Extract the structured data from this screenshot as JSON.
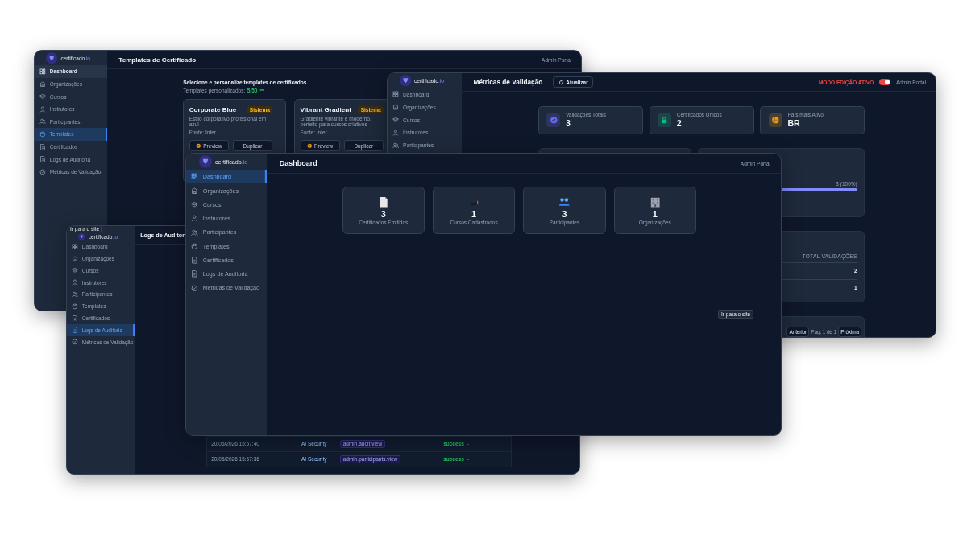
{
  "templates_window": {
    "sidebar": {
      "logo": "certificado",
      "logo_suffix": ".io",
      "items": [
        {
          "label": "Dashboard",
          "selected": false,
          "hovered": true
        },
        {
          "label": "Organizações",
          "selected": false,
          "hovered": false
        },
        {
          "label": "Cursos",
          "selected": false,
          "hovered": false
        },
        {
          "label": "Instrutores",
          "selected": false,
          "hovered": false
        },
        {
          "label": "Participantes",
          "selected": false,
          "hovered": false
        },
        {
          "label": "Templates",
          "selected": true,
          "hovered": false
        },
        {
          "label": "Certificados",
          "selected": false,
          "hovered": false
        },
        {
          "label": "Logs de Auditoria",
          "selected": false,
          "hovered": false
        },
        {
          "label": "Métricas de Validação",
          "selected": false,
          "hovered": false
        }
      ]
    },
    "header": {
      "title": "Templates de Certificado",
      "user": "Admin Portal"
    },
    "intro": "Selecione e personalize templates de certificados.",
    "counter_label": "Templates personalizados:",
    "counter_value": "5/50",
    "cards": [
      {
        "name": "Corporate Blue",
        "badge": "Sistema",
        "description": "Estilo corporativo profissional em azul",
        "font": "Fonte: Inter",
        "actions": [
          "Preview",
          "Duplicar"
        ]
      },
      {
        "name": "Vibrant Gradient",
        "badge": "Sistema",
        "description": "Gradiente vibrante e moderno, perfeito para cursos criativos",
        "font": "Fonte: Inter",
        "actions": [
          "Preview",
          "Duplicar"
        ]
      }
    ]
  },
  "metrics_window": {
    "sidebar": {
      "logo": "certificado",
      "logo_suffix": ".io",
      "items": [
        {
          "label": "Dashboard",
          "selected": false
        },
        {
          "label": "Organizações",
          "selected": false
        },
        {
          "label": "Cursos",
          "selected": false
        },
        {
          "label": "Instrutores",
          "selected": false
        },
        {
          "label": "Participantes",
          "selected": false
        }
      ]
    },
    "header": {
      "title": "Métricas de Validação",
      "refresh": "Atualizar",
      "mode_label": "MODO EDIÇÃO ATIVO",
      "mode_on": true,
      "user": "Admin Portal"
    },
    "stats": [
      {
        "label": "Validações Totais",
        "value": "3",
        "color": "#6366f1"
      },
      {
        "label": "Certificados Únicos",
        "value": "2",
        "color": "#10b981"
      },
      {
        "label": "País mais Ativo",
        "value": "BR",
        "color": "#f59e0b"
      }
    ],
    "country_bar": {
      "reading": "3 (100%)",
      "level": 1
    },
    "table": {
      "column": "TOTAL VALIDAÇÕES",
      "rows": [
        "2",
        "1"
      ]
    },
    "pagination": {
      "previous": "Anterior",
      "info": "Pág. 1 de 1",
      "next": "Próxima"
    }
  },
  "audit_window": {
    "tooltip": "Ir para o site",
    "sidebar": {
      "logo": "certificado",
      "logo_suffix": ".io",
      "items": [
        {
          "label": "Dashboard",
          "selected": false
        },
        {
          "label": "Organizações",
          "selected": false
        },
        {
          "label": "Cursos",
          "selected": false
        },
        {
          "label": "Instrutores",
          "selected": false
        },
        {
          "label": "Participantes",
          "selected": false
        },
        {
          "label": "Templates",
          "selected": false
        },
        {
          "label": "Certificados",
          "selected": false
        },
        {
          "label": "Logs de Auditoria",
          "selected": true
        },
        {
          "label": "Métricas de Validação",
          "selected": false
        }
      ]
    },
    "header": {
      "title": "Logs de Auditor"
    },
    "rows": [
      {
        "time": "20/05/2026 15:57:40",
        "user": "AI Security",
        "action": "admin.audit.view",
        "status": "success",
        "details": "-"
      },
      {
        "time": "20/05/2026 15:57:36",
        "user": "AI Security",
        "action": "admin.participants.view",
        "status": "success",
        "details": "-"
      }
    ]
  },
  "dashboard_window": {
    "sidebar": {
      "logo": "certificado",
      "logo_suffix": ".io",
      "items": [
        {
          "label": "Dashboard",
          "selected": true
        },
        {
          "label": "Organizações",
          "selected": false
        },
        {
          "label": "Cursos",
          "selected": false
        },
        {
          "label": "Instrutores",
          "selected": false
        },
        {
          "label": "Participantes",
          "selected": false
        },
        {
          "label": "Templates",
          "selected": false
        },
        {
          "label": "Certificados",
          "selected": false
        },
        {
          "label": "Logs de Auditoria",
          "selected": false
        },
        {
          "label": "Métricas de Validação",
          "selected": false
        }
      ]
    },
    "header": {
      "title": "Dashboard",
      "user": "Admin Portal"
    },
    "stats": [
      {
        "value": "3",
        "label": "Certificados Emitidos"
      },
      {
        "value": "1",
        "label": "Cursos Cadastrados"
      },
      {
        "value": "3",
        "label": "Participantes"
      },
      {
        "value": "1",
        "label": "Organizações"
      }
    ],
    "tooltip": "Ir para o site"
  }
}
